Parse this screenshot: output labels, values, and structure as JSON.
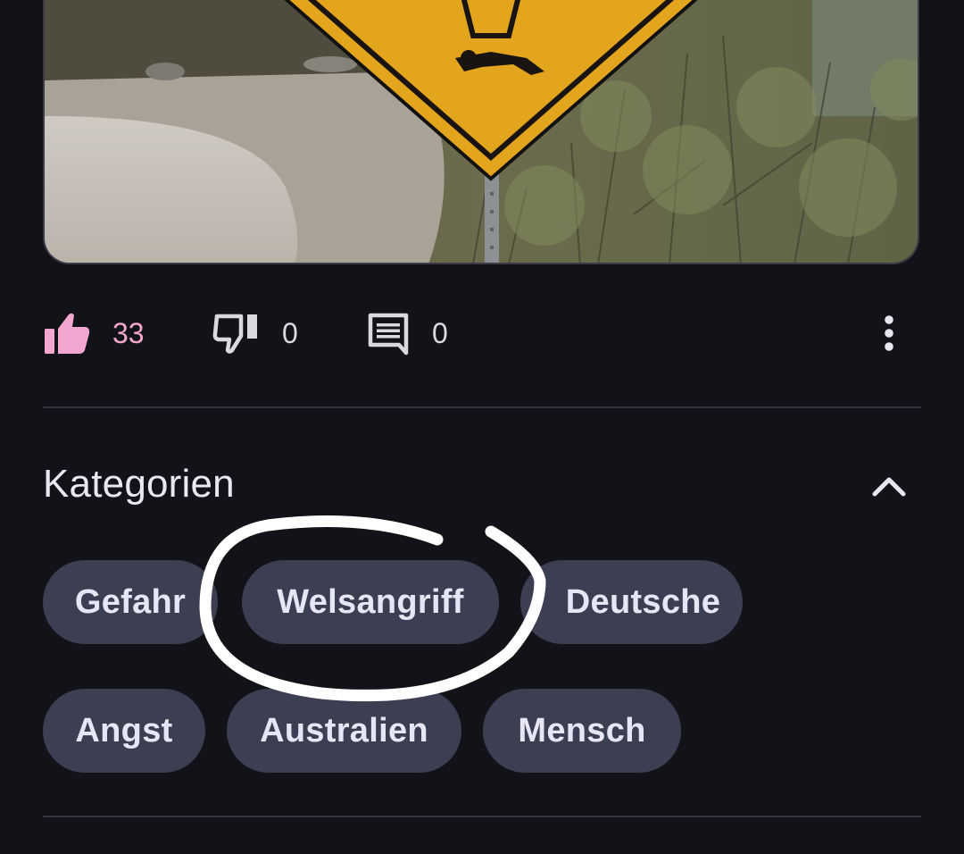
{
  "actions": {
    "likes": "33",
    "dislikes": "0",
    "comments": "0"
  },
  "categories": {
    "title": "Kategorien",
    "tags": [
      "Gefahr",
      "Welsangriff",
      "Deutsche",
      "Angst",
      "Australien",
      "Mensch"
    ]
  },
  "colors": {
    "background": "#121219",
    "chip": "#3c3f52",
    "like_accent": "#f3a6cf",
    "divider": "#33343f"
  },
  "icons": {
    "like": "thumb-up-filled-icon",
    "dislike": "thumb-down-outline-icon",
    "comment": "comment-icon",
    "more": "more-vertical-icon",
    "collapse": "chevron-up-icon"
  }
}
